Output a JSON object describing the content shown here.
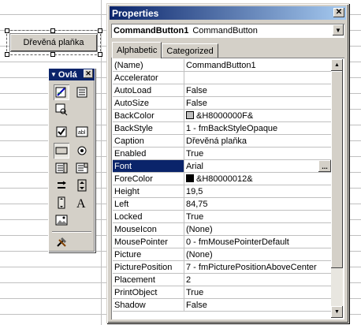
{
  "sheet_button": {
    "caption": "Dřevěná plaňka"
  },
  "toolbox": {
    "title": "Ovlá"
  },
  "properties": {
    "title": "Properties",
    "object_name": "CommandButton1",
    "object_type": "CommandButton",
    "tabs": [
      {
        "label": "Alphabetic",
        "active": true
      },
      {
        "label": "Categorized",
        "active": false
      }
    ],
    "rows": [
      {
        "name": "(Name)",
        "value": "CommandButton1"
      },
      {
        "name": "Accelerator",
        "value": ""
      },
      {
        "name": "AutoLoad",
        "value": "False"
      },
      {
        "name": "AutoSize",
        "value": "False"
      },
      {
        "name": "BackColor",
        "value": "&H8000000F&",
        "swatch": "#c0c0c0"
      },
      {
        "name": "BackStyle",
        "value": "1 - fmBackStyleOpaque"
      },
      {
        "name": "Caption",
        "value": "Dřevěná plaňka"
      },
      {
        "name": "Enabled",
        "value": "True"
      },
      {
        "name": "Font",
        "value": "Arial",
        "selected": true
      },
      {
        "name": "ForeColor",
        "value": "&H80000012&",
        "swatch": "#000000"
      },
      {
        "name": "Height",
        "value": "19,5"
      },
      {
        "name": "Left",
        "value": "84,75"
      },
      {
        "name": "Locked",
        "value": "True"
      },
      {
        "name": "MouseIcon",
        "value": "(None)"
      },
      {
        "name": "MousePointer",
        "value": "0 - fmMousePointerDefault"
      },
      {
        "name": "Picture",
        "value": "(None)"
      },
      {
        "name": "PicturePosition",
        "value": "7 - fmPicturePositionAboveCenter"
      },
      {
        "name": "Placement",
        "value": "2"
      },
      {
        "name": "PrintObject",
        "value": "True"
      },
      {
        "name": "Shadow",
        "value": "False"
      }
    ]
  },
  "colors": {
    "title_bar": "#0a246a",
    "face": "#d4d0c8"
  }
}
